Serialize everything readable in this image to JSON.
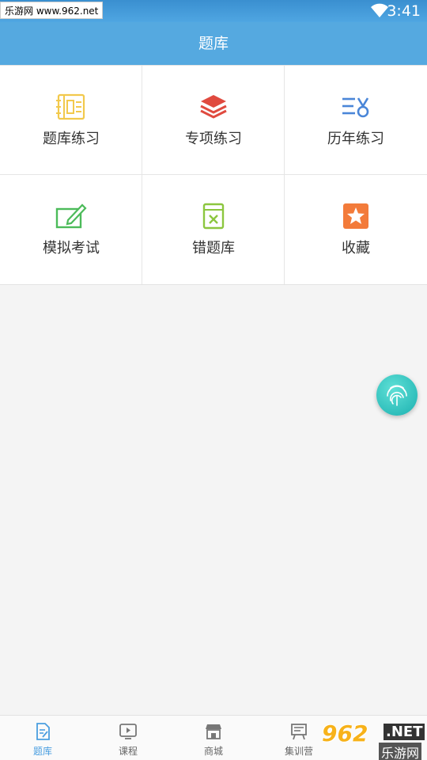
{
  "status_bar": {
    "watermark_text": "乐游网 www.962.net",
    "time": "3:41"
  },
  "header": {
    "title": "题库"
  },
  "grid": [
    {
      "label": "题库练习",
      "icon": "notebook-icon",
      "color": "#f2c94c"
    },
    {
      "label": "专项练习",
      "icon": "layers-icon",
      "color": "#e04a3f"
    },
    {
      "label": "历年练习",
      "icon": "list-medal-icon",
      "color": "#4a86d8"
    },
    {
      "label": "模拟考试",
      "icon": "edit-box-icon",
      "color": "#4cbb5a"
    },
    {
      "label": "错题库",
      "icon": "wrong-book-icon",
      "color": "#8cc63f"
    },
    {
      "label": "收藏",
      "icon": "star-icon",
      "color": "#f37b3a"
    }
  ],
  "tabs": [
    {
      "label": "题库",
      "icon": "question-bank-icon",
      "active": true
    },
    {
      "label": "课程",
      "icon": "video-icon",
      "active": false
    },
    {
      "label": "商城",
      "icon": "shop-icon",
      "active": false
    },
    {
      "label": "集训营",
      "icon": "training-icon",
      "active": false
    }
  ],
  "watermark": {
    "number": "962",
    "suffix": ".NET",
    "name": "乐游网"
  },
  "colors": {
    "accent": "#55a9e0",
    "active_tab": "#4a9ee0"
  }
}
